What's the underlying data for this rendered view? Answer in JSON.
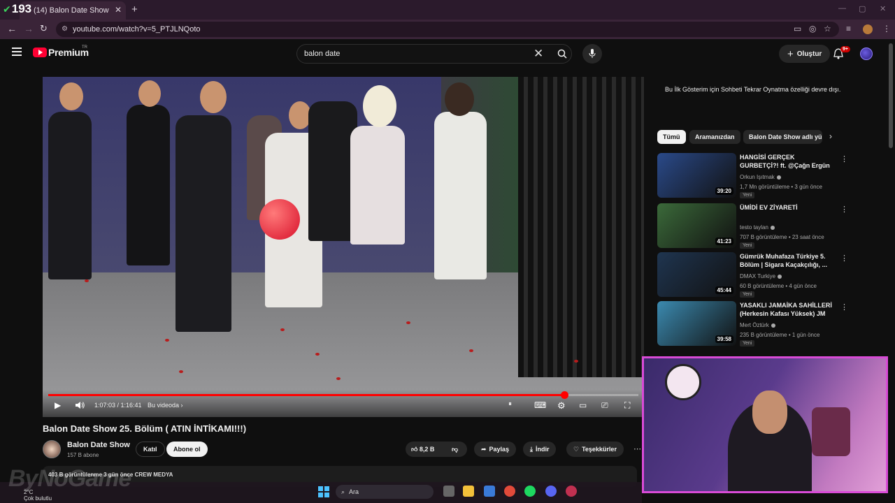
{
  "browser": {
    "counter": "193",
    "tab_title": "(14) Balon Date Show 25. Bölüm",
    "url": "youtube.com/watch?v=5_PTJLNQoto"
  },
  "header": {
    "logo_text": "Premium",
    "region": "TR",
    "search_value": "balon date",
    "create_label": "Oluştur",
    "notif_count": "9+"
  },
  "player": {
    "time": "1:07:03 / 1:16:41",
    "chapter": "Bu videoda",
    "progress": 0.874
  },
  "video": {
    "title": "Balon Date Show 25. Bölüm ( ATIN İNTİKAMI!!!)",
    "channel": "Balon Date Show",
    "subs": "157 B abone",
    "join_label": "Katıl",
    "subscribe_label": "Abone ol",
    "likes": "8,2 B",
    "share_label": "Paylaş",
    "download_label": "İndir",
    "thanks_label": "Teşekkürler",
    "description_line": "403 B görüntülenme  3 gün önce  CREW MEDYA"
  },
  "sidebar": {
    "chat_note": "Bu İlk Gösterim için Sohbeti Tekrar Oynatma özelliği devre dışı.",
    "chips": [
      "Tümü",
      "Aramanızdan",
      "Balon Date Show adlı yü"
    ],
    "recs": [
      {
        "title": "HANGİSİ GERÇEK GURBETÇİ?! ft. @Çağn Ergün",
        "channel": "Orkun Işıtmak",
        "meta": "1,7 Mn görüntüleme • 3 gün önce",
        "badge": "Yeni",
        "duration": "39:20",
        "thumb_color": "#2a4a8a"
      },
      {
        "title": "ÜMİDİ EV ZİYARETİ",
        "channel": "testo taylan",
        "meta": "707 B görüntüleme • 23 saat önce",
        "badge": "Yeni",
        "duration": "41:23",
        "thumb_color": "#3b6a3a"
      },
      {
        "title": "Gümrük Muhafaza Türkiye 5. Bölüm | Sigara Kaçakçılığı, ...",
        "channel": "DMAX Turkiye",
        "meta": "60 B görüntüleme • 4 gün önce",
        "badge": "Yeni",
        "duration": "45:44",
        "thumb_color": "#1f3550"
      },
      {
        "title": "YASAKLI JAMAİKA SAHİLLERİ (Herkesin Kafası Yüksek) JM",
        "channel": "Mert Öztürk",
        "meta": "235 B görüntüleme • 1 gün önce",
        "badge": "Yeni",
        "duration": "39:58",
        "thumb_color": "#3b8ab0"
      }
    ]
  },
  "taskbar": {
    "search_label": "Ara",
    "weather_temp": "2°C",
    "weather_desc": "Çok bulutlu",
    "watermark": "ByNoGame"
  }
}
